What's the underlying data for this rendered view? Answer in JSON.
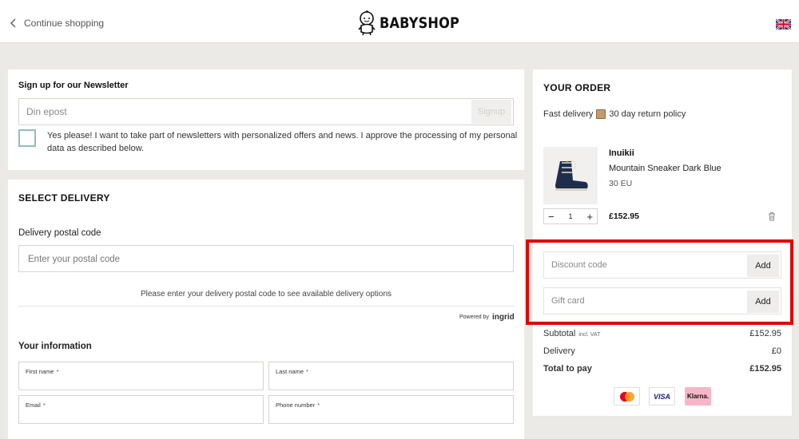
{
  "header": {
    "back_label": "Continue shopping",
    "logo_text": "BABYSHOP",
    "flag_icon": "uk-flag-icon"
  },
  "newsletter": {
    "title": "Sign up for our Newsletter",
    "email_placeholder": "Din epost",
    "signup_label": "Signup",
    "consent_text": "Yes please! I want to take part of newsletters with personalized offers and news. I approve the processing of my personal data as described below.",
    "checkbox_color": "#8ec1b6"
  },
  "delivery": {
    "title": "SELECT DELIVERY",
    "postal_label": "Delivery postal code",
    "postal_placeholder": "Enter your postal code",
    "note": "Please enter your delivery postal code to see available delivery options",
    "powered_by": "Powered by",
    "provider": "ingrid"
  },
  "your_information": {
    "title": "Your information",
    "first_name": "First name",
    "last_name": "Last name",
    "email": "Email",
    "phone": "Phone number",
    "required_mark": "*"
  },
  "order": {
    "title": "YOUR ORDER",
    "fast_delivery": "Fast delivery",
    "return_policy": "30 day return policy",
    "product": {
      "brand": "Inuikii",
      "name": "Mountain Sneaker Dark Blue",
      "size": "30 EU",
      "quantity": "1",
      "price": "£152.95",
      "decrement": "−",
      "increment": "+"
    },
    "discount_placeholder": "Discount code",
    "gift_placeholder": "Gift card",
    "add_label": "Add",
    "subtotal_label": "Subtotal",
    "subtotal_vat": "incl. VAT",
    "subtotal_value": "£152.95",
    "delivery_label": "Delivery",
    "delivery_value": "£0",
    "total_label": "Total to pay",
    "total_value": "£152.95",
    "payments": {
      "visa": "VISA",
      "klarna": "Klarna."
    },
    "highlight_color": "#e10600"
  }
}
